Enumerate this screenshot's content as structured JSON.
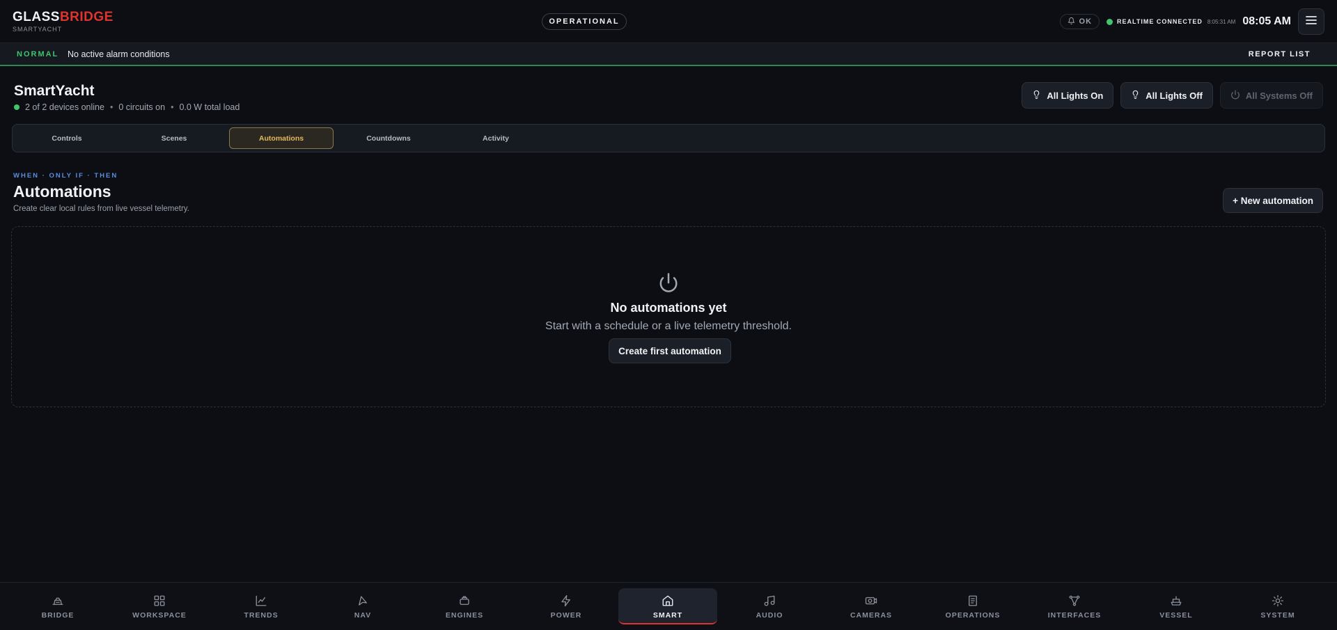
{
  "brand": {
    "name_part1": "GLASS",
    "name_part2": "BRIDGE",
    "subtitle": "SMARTYACHT"
  },
  "header": {
    "status": "OPERATIONAL",
    "alarm_badge": "OK",
    "realtime_label": "REALTIME CONNECTED",
    "realtime_time": "8:05:31 AM",
    "clock": "08:05 AM"
  },
  "alarm_bar": {
    "state": "NORMAL",
    "message": "No active alarm conditions",
    "report_label": "REPORT LIST"
  },
  "page": {
    "title": "SmartYacht",
    "devices_online": "2 of 2 devices online",
    "circuits_on": "0 circuits on",
    "total_load": "0.0 W total load",
    "separator": "•"
  },
  "quick_actions": {
    "lights_on": "All Lights On",
    "lights_off": "All Lights Off",
    "systems_off": "All Systems Off"
  },
  "tabs": [
    {
      "label": "Controls"
    },
    {
      "label": "Scenes"
    },
    {
      "label": "Automations"
    },
    {
      "label": "Countdowns"
    },
    {
      "label": "Activity"
    }
  ],
  "section": {
    "eyebrow": "WHEN · ONLY IF · THEN",
    "title": "Automations",
    "subtitle": "Create clear local rules from live vessel telemetry.",
    "new_button": "+ New automation"
  },
  "empty_state": {
    "icon": "power-icon",
    "title": "No automations yet",
    "description": "Start with a schedule or a live telemetry threshold.",
    "button": "Create first automation"
  },
  "bottom_nav": [
    {
      "label": "BRIDGE",
      "icon": "helm-icon"
    },
    {
      "label": "WORKSPACE",
      "icon": "grid-icon"
    },
    {
      "label": "TRENDS",
      "icon": "chart-icon"
    },
    {
      "label": "NAV",
      "icon": "navigation-icon"
    },
    {
      "label": "ENGINES",
      "icon": "engine-icon"
    },
    {
      "label": "POWER",
      "icon": "bolt-icon"
    },
    {
      "label": "SMART",
      "icon": "home-icon"
    },
    {
      "label": "AUDIO",
      "icon": "music-icon"
    },
    {
      "label": "CAMERAS",
      "icon": "camera-icon"
    },
    {
      "label": "OPERATIONS",
      "icon": "clipboard-icon"
    },
    {
      "label": "INTERFACES",
      "icon": "network-icon"
    },
    {
      "label": "VESSEL",
      "icon": "ship-icon"
    },
    {
      "label": "SYSTEM",
      "icon": "gear-icon"
    }
  ],
  "colors": {
    "accent_red": "#e0332e",
    "ok_green": "#3fc56b",
    "tab_active": "#e3b85e",
    "eyebrow_blue": "#5b8ee0"
  }
}
